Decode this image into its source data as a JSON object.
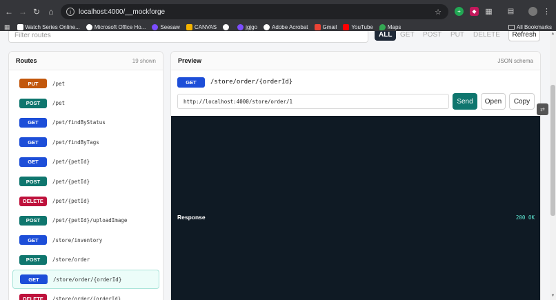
{
  "browser": {
    "url": "localhost:4000/__mockforge",
    "bookmarks": [
      {
        "label": "Watch Series Online...",
        "color": "#ffffff"
      },
      {
        "label": "Microsoft Office Ho...",
        "color": "#ffffff"
      },
      {
        "label": "Seesaw",
        "color": "#7c4dff"
      },
      {
        "label": "CANVAS",
        "color": "#f5b400"
      },
      {
        "label": "",
        "color": "#ffffff"
      },
      {
        "label": "jgjgo",
        "color": "#7c4dff"
      },
      {
        "label": "Adobe Acrobat",
        "color": "#ffffff"
      },
      {
        "label": "Gmail",
        "color": "#ea4335"
      },
      {
        "label": "YouTube",
        "color": "#ff0000"
      },
      {
        "label": "Maps",
        "color": "#34a853"
      }
    ],
    "all_bookmarks": "All Bookmarks"
  },
  "toolbar": {
    "filter_placeholder": "Filter routes",
    "methods": [
      "ALL",
      "GET",
      "POST",
      "PUT",
      "DELETE"
    ],
    "refresh": "Refresh"
  },
  "routes": {
    "title": "Routes",
    "count": "19 shown",
    "items": [
      {
        "method": "PUT",
        "path": "/pet",
        "color": "#c2570c"
      },
      {
        "method": "POST",
        "path": "/pet",
        "color": "#0f766e"
      },
      {
        "method": "GET",
        "path": "/pet/findByStatus",
        "color": "#1d4ed8"
      },
      {
        "method": "GET",
        "path": "/pet/findByTags",
        "color": "#1d4ed8"
      },
      {
        "method": "GET",
        "path": "/pet/{petId}",
        "color": "#1d4ed8"
      },
      {
        "method": "POST",
        "path": "/pet/{petId}",
        "color": "#0f766e"
      },
      {
        "method": "DELETE",
        "path": "/pet/{petId}",
        "color": "#be123c"
      },
      {
        "method": "POST",
        "path": "/pet/{petId}/uploadImage",
        "color": "#0f766e"
      },
      {
        "method": "GET",
        "path": "/store/inventory",
        "color": "#1d4ed8"
      },
      {
        "method": "POST",
        "path": "/store/order",
        "color": "#0f766e"
      },
      {
        "method": "GET",
        "path": "/store/order/{orderId}",
        "color": "#1d4ed8",
        "selected": true
      },
      {
        "method": "DELETE",
        "path": "/store/order/{orderId}",
        "color": "#be123c"
      }
    ]
  },
  "preview": {
    "title": "Preview",
    "schema_link": "JSON schema",
    "method": "GET",
    "path": "/store/order/{orderId}",
    "url": "http://localhost:4000/store/order/1",
    "send": "Send",
    "open": "Open",
    "copy": "Copy",
    "response_label": "Response",
    "status": "200 OK"
  }
}
